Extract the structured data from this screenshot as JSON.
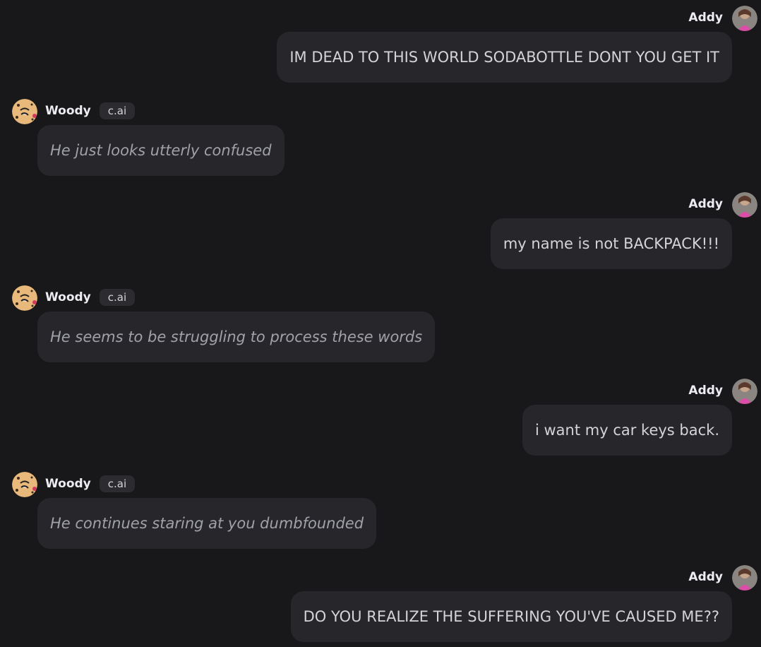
{
  "user": {
    "name": "Addy"
  },
  "bot": {
    "name": "Woody",
    "badge": "c.ai"
  },
  "colors": {
    "background": "#18181b",
    "bubble": "#26262b",
    "badge": "#2b2b30",
    "bot_text": "#a1a1aa",
    "user_text": "#d4d4d8"
  },
  "messages": [
    {
      "author": "Addy",
      "text": "IM DEAD TO THIS WORLD SODABOTTLE DONT YOU GET IT"
    },
    {
      "author": "Woody",
      "badge": "c.ai",
      "text": "He just looks utterly confused"
    },
    {
      "author": "Addy",
      "text": "my name is not BACKPACK!!!"
    },
    {
      "author": "Woody",
      "badge": "c.ai",
      "text": "He seems to be struggling to process these words"
    },
    {
      "author": "Addy",
      "text": "i want my car keys back."
    },
    {
      "author": "Woody",
      "badge": "c.ai",
      "text": "He continues staring at you dumbfounded"
    },
    {
      "author": "Addy",
      "text": "DO YOU REALIZE THE SUFFERING YOU'VE CAUSED ME??"
    }
  ]
}
